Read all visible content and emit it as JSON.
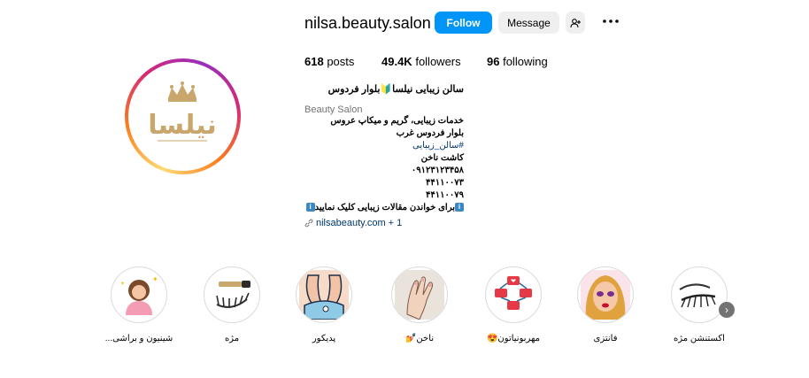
{
  "profile": {
    "username": "nilsa.beauty.salon",
    "follow_label": "Follow",
    "message_label": "Message",
    "logo_text": "نیلسا"
  },
  "stats": {
    "posts_count": "618",
    "posts_label": "posts",
    "followers_count": "49.4K",
    "followers_label": "followers",
    "following_count": "96",
    "following_label": "following"
  },
  "bio": {
    "name": "سالن زیبایی نیلسا🔰بلوار فردوس",
    "category": "Beauty Salon",
    "lines": [
      "خدمات زیبایی، گریم و میکاپ عروس",
      "بلوار فردوس غرب",
      "#سالن_زیبایی",
      "کاشت ناخن",
      "۰۹۱۲۳۱۲۳۴۵۸",
      "۴۴۱۱۰۰۷۳",
      "۴۴۱۱۰۰۷۹",
      "برای خواندن مقالات زیبایی کلیک نمایید"
    ],
    "link_text": "nilsabeauty.com",
    "link_more": "+ 1"
  },
  "highlights": [
    {
      "label": "شینیون و براشی..."
    },
    {
      "label": "مژه"
    },
    {
      "label": "پدیکور"
    },
    {
      "label": "ناخن💅"
    },
    {
      "label": "مهربونیاتون😍"
    },
    {
      "label": "فانتزی"
    },
    {
      "label": "اکستنشن مژه"
    }
  ],
  "colors": {
    "accent": "#0095f6",
    "link": "#00376b",
    "gold": "#c9a66b"
  }
}
